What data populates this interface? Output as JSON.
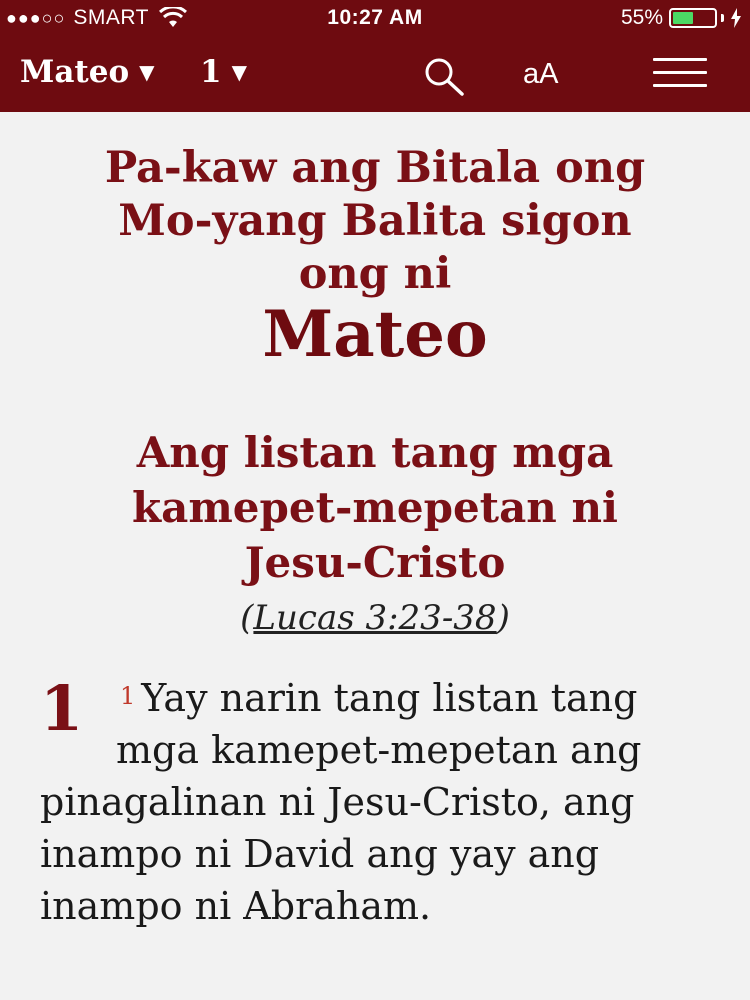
{
  "status_bar": {
    "signal": "●●●○○",
    "carrier": "SMART",
    "time": "10:27 AM",
    "battery_percent": "55%",
    "battery_level": 0.55
  },
  "nav": {
    "book": "Mateo",
    "chapter": "1",
    "caret": "▼",
    "font_button": "aA",
    "icons": [
      "search-icon",
      "menu-icon"
    ]
  },
  "colors": {
    "bar": "#6e0b10",
    "heading": "#7a1016",
    "battery": "#4cd964",
    "verse_number": "#c0392b"
  },
  "content": {
    "title_lines": [
      "Pa-kaw ang Bitala ong",
      "Mo-yang Balita sigon",
      "ong ni"
    ],
    "book_name": "Mateo",
    "section_lines": [
      "Ang listan tang mga",
      "kamepet-mepetan ni",
      "Jesu-Cristo"
    ],
    "cross_ref_open": "(",
    "cross_ref": "Lucas 3:23-38",
    "cross_ref_close": ")",
    "chapter_number": "1",
    "verse_number": "1",
    "verse_text": "Yay narin tang listan tang mga kamepet-mepetan ang pinagalinan ni Jesu-Cristo, ang inampo ni David ang yay ang inampo ni Abraham."
  }
}
